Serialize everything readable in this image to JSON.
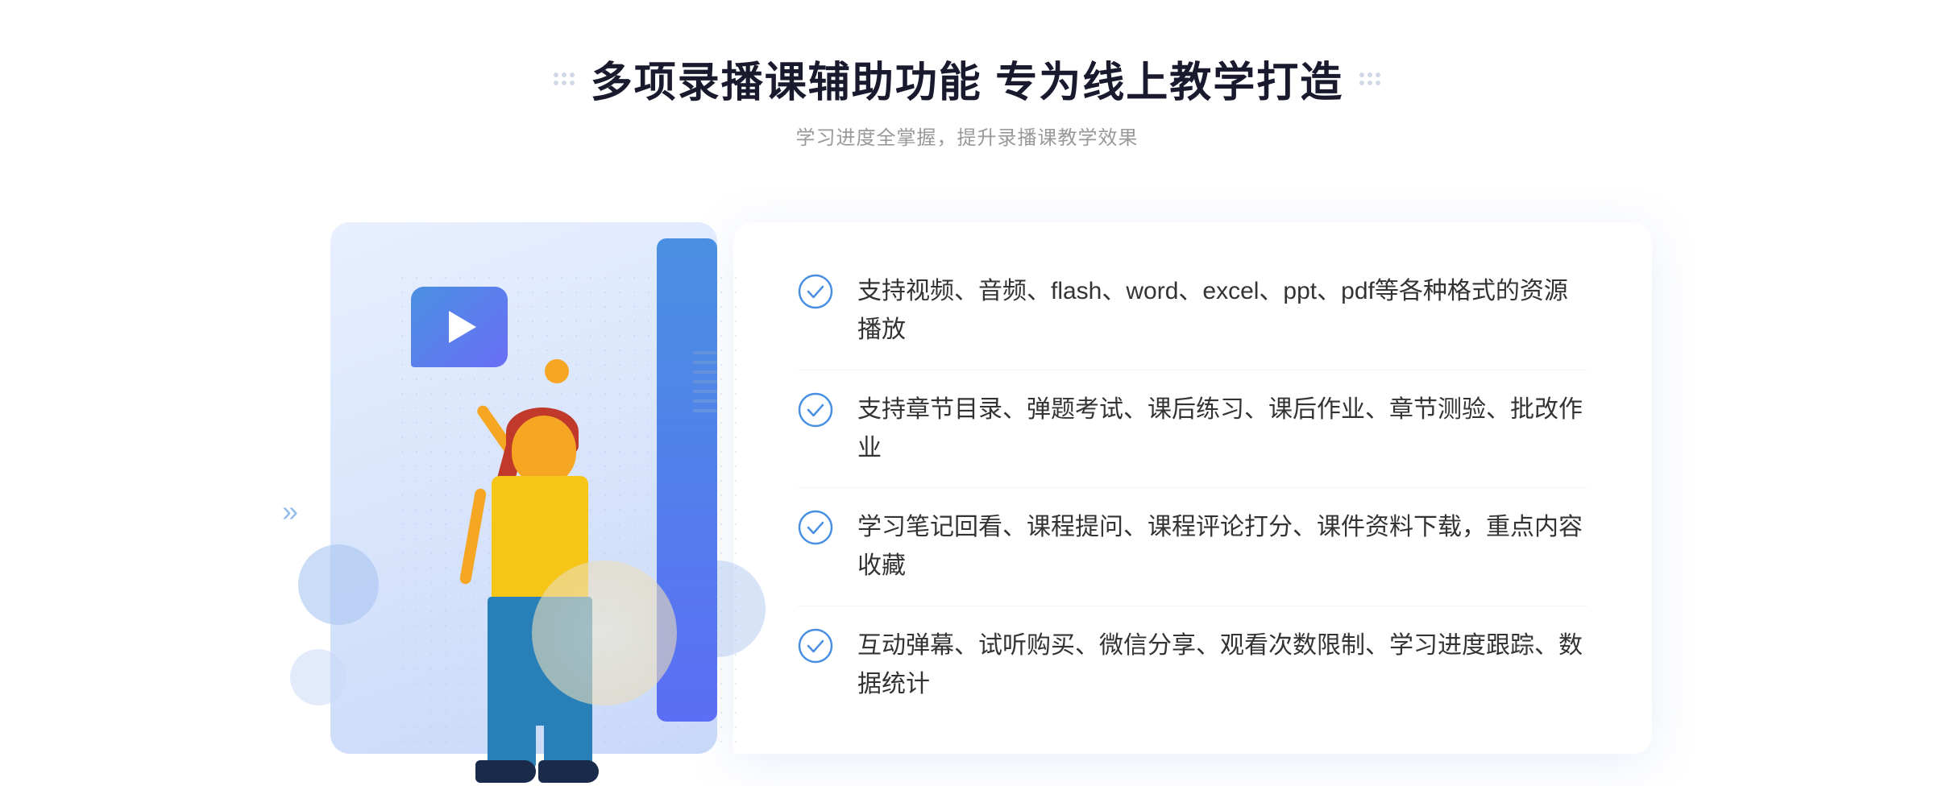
{
  "page": {
    "background": "#ffffff"
  },
  "header": {
    "title": "多项录播课辅助功能 专为线上教学打造",
    "subtitle": "学习进度全掌握，提升录播课教学效果"
  },
  "features": [
    {
      "id": "feature-1",
      "text": "支持视频、音频、flash、word、excel、ppt、pdf等各种格式的资源播放"
    },
    {
      "id": "feature-2",
      "text": "支持章节目录、弹题考试、课后练习、课后作业、章节测验、批改作业"
    },
    {
      "id": "feature-3",
      "text": "学习笔记回看、课程提问、课程评论打分、课件资料下载，重点内容收藏"
    },
    {
      "id": "feature-4",
      "text": "互动弹幕、试听购买、微信分享、观看次数限制、学习进度跟踪、数据统计"
    }
  ],
  "icons": {
    "check": "check-circle-icon",
    "play": "play-icon",
    "chevron": "chevron-right-icon"
  },
  "colors": {
    "primary": "#4a90e2",
    "accent": "#5b6ef5",
    "title": "#1a1a2e",
    "text": "#333333",
    "subtitle": "#999999",
    "check": "#4a90e2"
  }
}
